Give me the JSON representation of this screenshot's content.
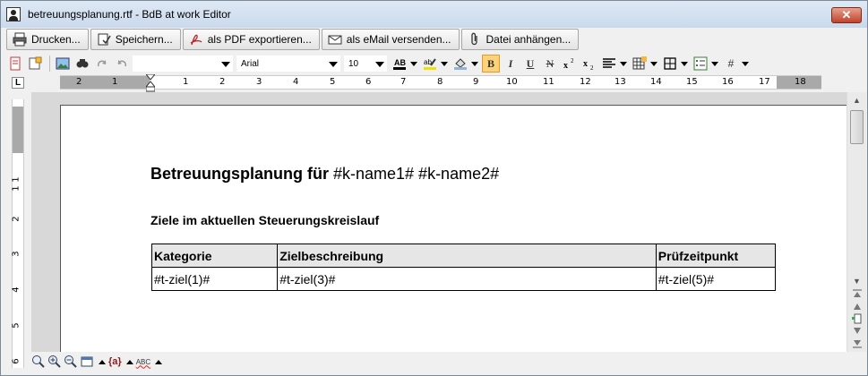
{
  "window": {
    "title": "betreuungsplanung.rtf - BdB at work Editor",
    "close_label": "✕"
  },
  "actions": [
    {
      "label": "Drucken...",
      "icon": "printer-icon"
    },
    {
      "label": "Speichern...",
      "icon": "save-icon"
    },
    {
      "label": "als PDF exportieren...",
      "icon": "pdf-icon"
    },
    {
      "label": "als eMail versenden...",
      "icon": "email-icon"
    },
    {
      "label": "Datei anhängen...",
      "icon": "paperclip-icon"
    }
  ],
  "format": {
    "style_value": "",
    "font_value": "Arial",
    "size_value": "10"
  },
  "ruler": {
    "corner_label": "L",
    "h_numbers_left": [
      "2",
      "1"
    ],
    "h_numbers": [
      "1",
      "2",
      "3",
      "4",
      "5",
      "6",
      "7",
      "8",
      "9",
      "10",
      "11",
      "12",
      "13",
      "14",
      "15",
      "16",
      "17",
      "18"
    ],
    "v_numbers": [
      "1",
      "1",
      "2",
      "3",
      "4",
      "5",
      "6"
    ]
  },
  "document": {
    "title_bold": "Betreuungsplanung für",
    "title_rest": " #k-name1# #k-name2#",
    "subtitle": "Ziele im aktuellen Steuerungskreislauf",
    "table": {
      "headers": [
        "Kategorie",
        "Zielbeschreibung",
        "Prüfzeitpunkt"
      ],
      "rows": [
        [
          "#t-ziel(1)#",
          "#t-ziel(3)#",
          "#t-ziel(5)#"
        ]
      ]
    }
  },
  "status": {
    "field_label": "{a}",
    "spell_label": "ABC"
  }
}
